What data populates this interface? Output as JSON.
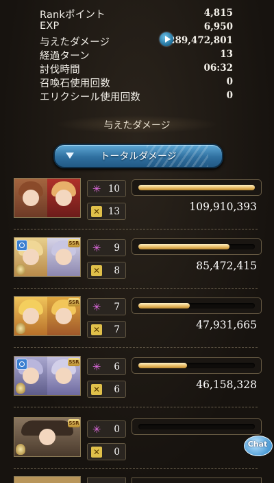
{
  "stats": [
    {
      "label": "Rankポイント",
      "value": "4,815"
    },
    {
      "label": "EXP",
      "value": "6,950"
    },
    {
      "label": "与えたダメージ",
      "value": "289,472,801"
    },
    {
      "label": "経過ターン",
      "value": "13"
    },
    {
      "label": "討伐時間",
      "value": "06:32"
    },
    {
      "label": "召喚石使用回数",
      "value": "0"
    },
    {
      "label": "エリクシール使用回数",
      "value": "0"
    }
  ],
  "section_title": "与えたダメージ",
  "total_button": "トータルダメージ",
  "rows": [
    {
      "skill_count": "10",
      "chain_count": "13",
      "damage": "109,910,393",
      "bar_fraction": 1.0
    },
    {
      "skill_count": "9",
      "chain_count": "8",
      "damage": "85,472,415",
      "bar_fraction": 0.78
    },
    {
      "skill_count": "7",
      "chain_count": "7",
      "damage": "47,931,665",
      "bar_fraction": 0.44
    },
    {
      "skill_count": "6",
      "chain_count": "6",
      "damage": "46,158,328",
      "bar_fraction": 0.42
    },
    {
      "skill_count": "0",
      "chain_count": "0",
      "damage": "",
      "bar_fraction": 0.0
    }
  ],
  "badges": {
    "ssr": "SSR"
  },
  "chat_label": "Chat",
  "colors": {
    "accent_blue": "#2f6f9f",
    "bar_gold": "#e6b860",
    "skill_star": "#e06be0",
    "chain_gold": "#e0c04a"
  }
}
